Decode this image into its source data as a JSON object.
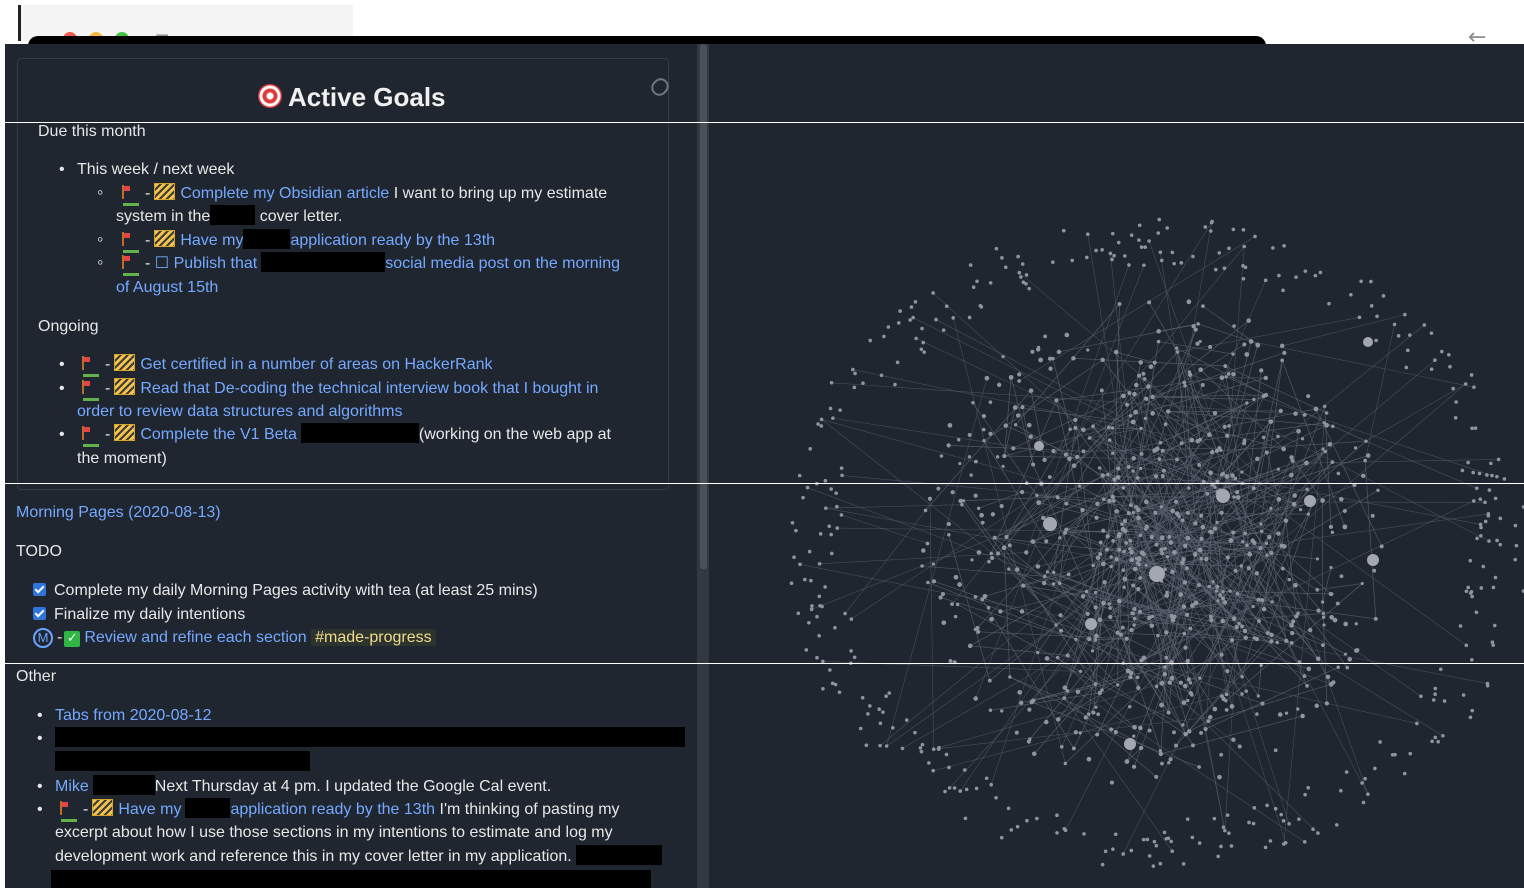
{
  "window": {
    "traffic_lights": [
      "close",
      "minimize",
      "maximize"
    ],
    "toolbar_icons": [
      "menu-icon",
      "search-icon"
    ],
    "back_icon": "back-arrow-icon"
  },
  "active_goals": {
    "title": "Active Goals",
    "due_this_month_label": "Due this month",
    "this_week_label": "This week / next week",
    "items": [
      {
        "text_a": "Complete my Obsidian article",
        "text_b": " I want to bring up my estimate",
        "text_c": "system in the",
        "text_d": " cover letter."
      },
      {
        "text_a": "Have my",
        "text_b": "application ready by the 13th"
      },
      {
        "prefix": "☐",
        "text_a": "Publish that",
        "text_b": "social media post on the morning",
        "text_c": "of August 15th"
      }
    ],
    "ongoing_label": "Ongoing",
    "ongoing_items": [
      {
        "text": "Get certified in a number of areas on HackerRank"
      },
      {
        "text_a": "Read that De-coding the technical interview book that I bought in",
        "text_b": "order to review data structures and algorithms"
      },
      {
        "text_a": "Complete the V1 Beta",
        "text_b": "(working on the web app at",
        "text_c": "the moment)"
      }
    ]
  },
  "morning_pages": {
    "link": "Morning Pages (2020-08-13)",
    "todo_label": "TODO",
    "todos": [
      {
        "text": "Complete my daily Morning Pages activity with tea (at least 25 mins)",
        "checked": true
      },
      {
        "text": "Finalize my daily intentions",
        "checked": true
      }
    ],
    "progress_link": "Review and refine each section",
    "progress_tag": "#made-progress",
    "m_badge": "M"
  },
  "other": {
    "label": "Other",
    "items": [
      {
        "text": "Tabs from 2020-08-12"
      },
      {
        "text_a": "Mike",
        "text_b": "Next Thursday at 4 pm. I updated the Google Cal event."
      },
      {
        "text_a": "Have my",
        "text_b": "application ready by the 13th",
        "text_c": " I'm thinking of pasting my",
        "text_d": "excerpt about how I use those sections in my intentions to estimate and log my",
        "text_e": "development work and reference this in my cover letter in my application."
      }
    ]
  },
  "graph": {
    "node_color": "#8f959f",
    "edge_color": "#5c6470"
  }
}
